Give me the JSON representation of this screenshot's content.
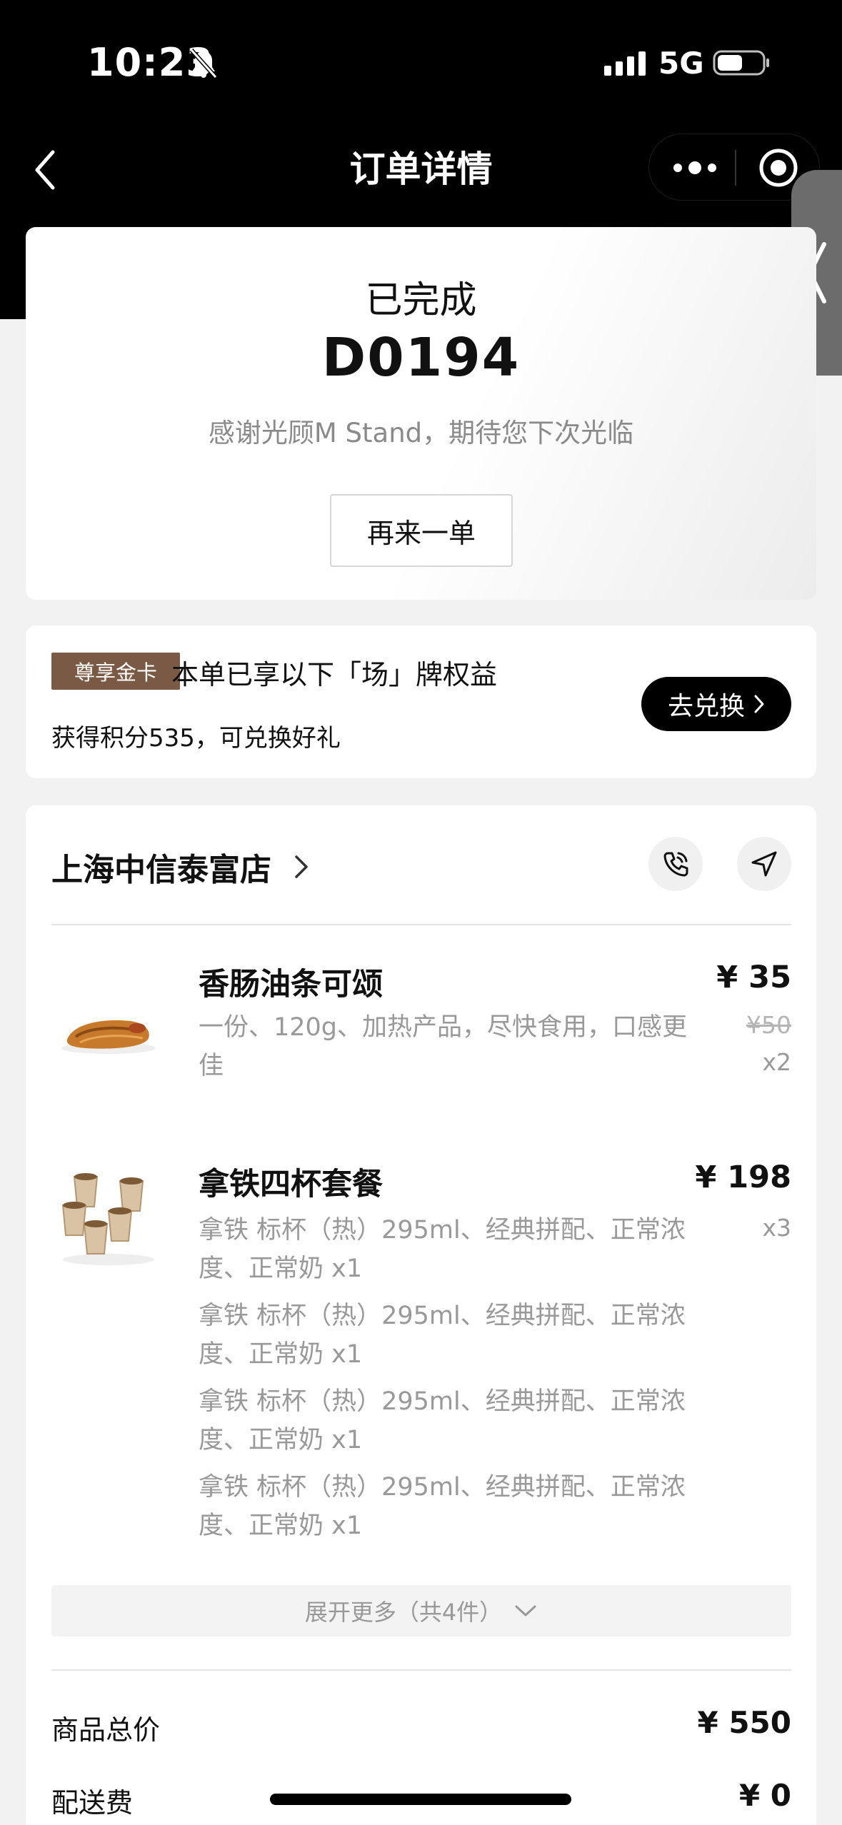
{
  "status_bar": {
    "time": "10:23",
    "network": "5G"
  },
  "nav": {
    "title": "订单详情"
  },
  "order": {
    "status": "已完成",
    "number": "D0194",
    "thanks": "感谢光顾M Stand，期待您下次光临",
    "reorder_label": "再来一单"
  },
  "member": {
    "badge": "尊享金卡",
    "title": "本单已享以下「场」牌权益",
    "points": "获得积分535，可兑换好礼",
    "redeem_label": "去兑换"
  },
  "store": {
    "name": "上海中信泰富店",
    "items": [
      {
        "name": "香肠油条可颂",
        "desc": [
          "一份、120g、加热产品，尽快食用，口感更",
          "佳"
        ],
        "price": "¥ 35",
        "original_price": "¥50",
        "qty": "x2"
      },
      {
        "name": "拿铁四杯套餐",
        "desc": [
          "拿铁 标杯（热）295ml、经典拼配、正常浓",
          "度、正常奶 x1",
          "拿铁 标杯（热）295ml、经典拼配、正常浓",
          "度、正常奶 x1",
          "拿铁 标杯（热）295ml、经典拼配、正常浓",
          "度、正常奶 x1",
          "拿铁 标杯（热）295ml、经典拼配、正常浓",
          "度、正常奶 x1"
        ],
        "price": "¥ 198",
        "qty": "x3"
      }
    ],
    "expand_label": "展开更多（共4件）"
  },
  "summary": {
    "subtotal_label": "商品总价",
    "subtotal_value": "¥ 550",
    "delivery_label": "配送费",
    "delivery_value": "¥ 0"
  },
  "icons": [
    "bell-mute-icon",
    "signal-icon",
    "battery-icon",
    "back-icon",
    "more-icon",
    "record-icon",
    "side-chevron-icon",
    "chevron-right-icon",
    "phone-icon",
    "navigation-icon",
    "chevron-down-icon"
  ],
  "colors": {
    "header": "#000000",
    "badge": "#7a5a44",
    "muted_text": "#999999",
    "background": "#f2f2f2"
  }
}
